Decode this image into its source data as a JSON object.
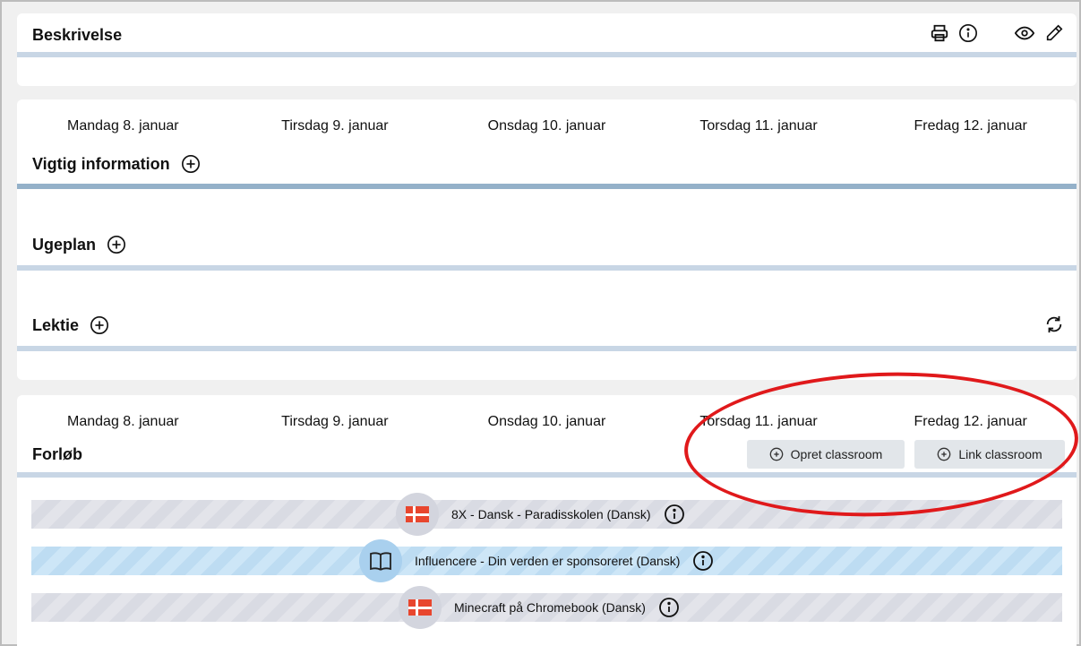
{
  "description": {
    "title": "Beskrivelse"
  },
  "week": {
    "days": [
      "Mandag 8. januar",
      "Tirsdag 9. januar",
      "Onsdag 10. januar",
      "Torsdag 11. januar",
      "Fredag 12. januar"
    ]
  },
  "sections": {
    "important_info": "Vigtig information",
    "weekplan": "Ugeplan",
    "homework": "Lektie"
  },
  "courses": {
    "title": "Forløb",
    "create_classroom": "Opret classroom",
    "link_classroom": "Link classroom",
    "items": [
      {
        "label": "8X - Dansk - Paradisskolen (Dansk)",
        "icon": "danish-flag-icon",
        "style": "gray"
      },
      {
        "label": "Influencere - Din verden er sponsoreret (Dansk)",
        "icon": "book-icon",
        "style": "blue"
      },
      {
        "label": "Minecraft på Chromebook (Dansk)",
        "icon": "danish-flag-icon",
        "style": "gray"
      }
    ]
  },
  "colors": {
    "rule_light": "#c8d6e5",
    "rule_dark": "#94b1c9",
    "highlight": "#e0191b",
    "flag_red": "#e8462e"
  }
}
